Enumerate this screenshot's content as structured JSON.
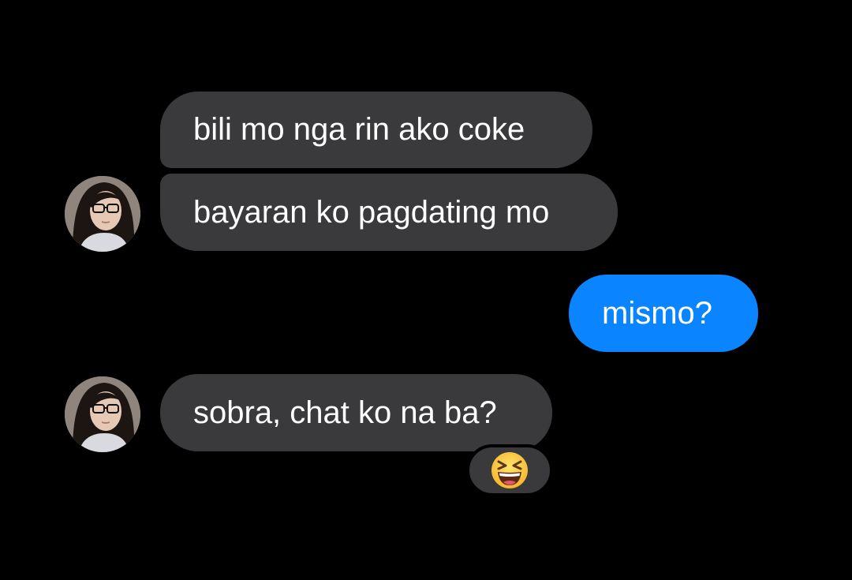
{
  "conversation": {
    "messages": [
      {
        "direction": "incoming",
        "text": "bili mo nga rin ako coke"
      },
      {
        "direction": "incoming",
        "text": "bayaran ko pagdating mo"
      },
      {
        "direction": "outgoing",
        "text": "mismo?"
      },
      {
        "direction": "incoming",
        "text": "sobra, chat ko na ba?"
      }
    ],
    "reaction": {
      "icon": "laughing-squinting-face-icon",
      "glyph": "😆"
    }
  },
  "colors": {
    "background": "#000000",
    "incoming_bubble": "#3a3a3c",
    "outgoing_bubble": "#0a84ff",
    "text": "#ffffff"
  }
}
